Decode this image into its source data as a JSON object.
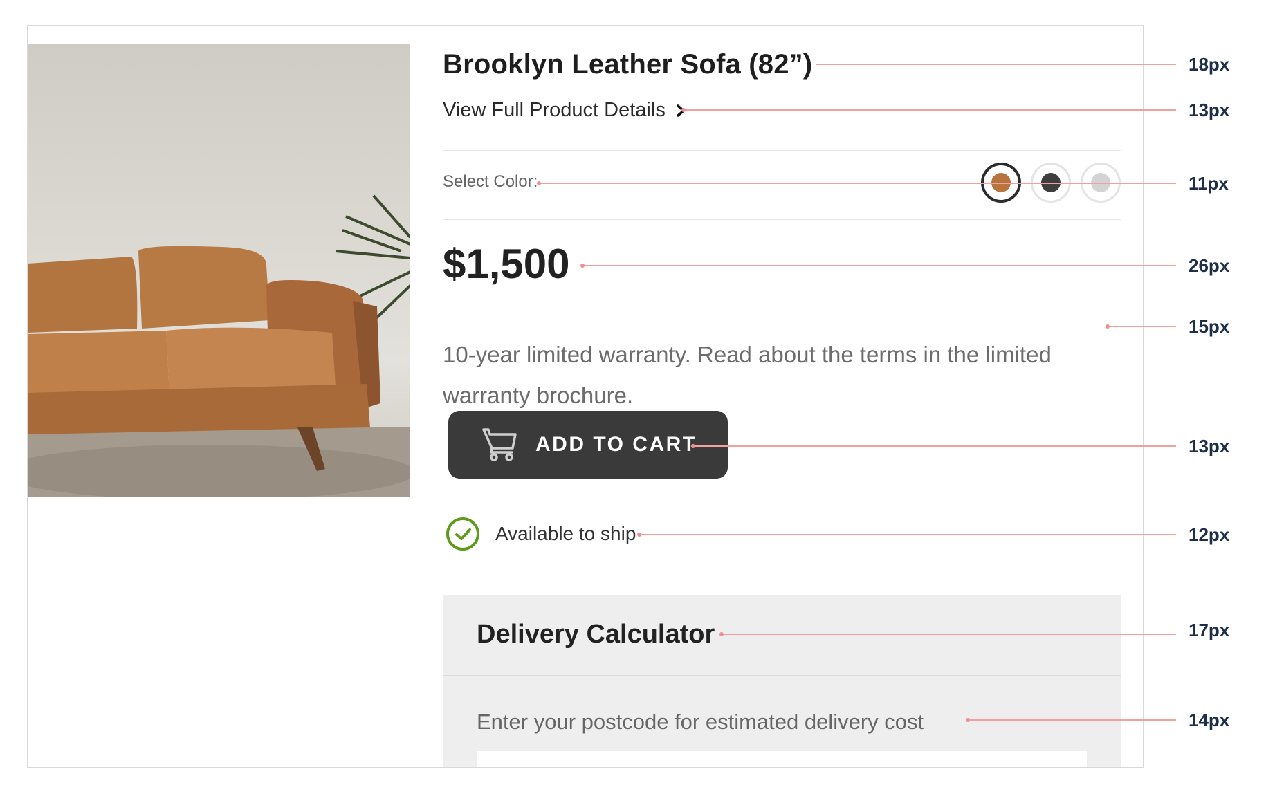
{
  "product": {
    "title": "Brooklyn Leather Sofa (82”)",
    "details_link": "View Full Product Details",
    "color_label": "Select Color:",
    "colors": [
      {
        "name": "tan",
        "hex": "#b8743f",
        "selected": true
      },
      {
        "name": "charcoal",
        "hex": "#3e3e3e",
        "selected": false
      },
      {
        "name": "light-grey",
        "hex": "#d3d3d3",
        "selected": false
      }
    ],
    "price": "$1,500",
    "warranty_prefix": "10-year limited warranty. Read about the terms in the ",
    "warranty_link": "limited warranty brochure",
    "warranty_suffix": ".",
    "cart_button": "ADD TO CART",
    "availability": "Available to ship"
  },
  "delivery": {
    "title": "Delivery Calculator",
    "hint": "Enter your postcode for estimated delivery cost",
    "postcode_value": "",
    "postcode_placeholder": ""
  },
  "annotations": {
    "title_size": "18px",
    "link_size": "13px",
    "color_label_size": "11px",
    "price_size": "26px",
    "warranty_size": "15px",
    "button_size": "13px",
    "ship_size": "12px",
    "delivery_title_size": "17px",
    "delivery_hint_size": "14px"
  },
  "colors": {
    "annotation_line": "#f0a0a0",
    "annotation_label": "#1f2f4a",
    "button_bg": "#3a3a3a",
    "check_green": "#5f9a1e",
    "panel_bg": "#eeeeee"
  }
}
